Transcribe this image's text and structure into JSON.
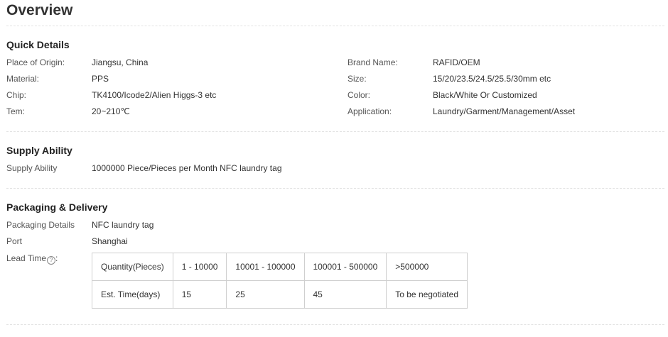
{
  "title": "Overview",
  "quick_details": {
    "heading": "Quick Details",
    "left": [
      {
        "label": "Place of Origin:",
        "value": "Jiangsu, China"
      },
      {
        "label": "Material:",
        "value": "PPS"
      },
      {
        "label": "Chip:",
        "value": "TK4100/Icode2/Alien Higgs-3 etc"
      },
      {
        "label": "Tem:",
        "value": "20~210℃"
      }
    ],
    "right": [
      {
        "label": "Brand Name:",
        "value": "RAFID/OEM"
      },
      {
        "label": "Size:",
        "value": "15/20/23.5/24.5/25.5/30mm etc"
      },
      {
        "label": "Color:",
        "value": "Black/White Or Customized"
      },
      {
        "label": "Application:",
        "value": "Laundry/Garment/Management/Asset"
      }
    ]
  },
  "supply_ability": {
    "heading": "Supply Ability",
    "label": "Supply Ability",
    "value": "1000000 Piece/Pieces per Month NFC laundry tag"
  },
  "packaging": {
    "heading": "Packaging & Delivery",
    "details_label": "Packaging Details",
    "details_value": "NFC laundry tag",
    "port_label": "Port",
    "port_value": "Shanghai",
    "lead_time_label": "Lead Time",
    "lead_time_suffix": ":",
    "help_icon": "question-circle-icon",
    "help_glyph": "?",
    "lead_table": {
      "rows": [
        [
          "Quantity(Pieces)",
          "1 - 10000",
          "10001 - 100000",
          "100001 - 500000",
          ">500000"
        ],
        [
          "Est. Time(days)",
          "15",
          "25",
          "45",
          "To be negotiated"
        ]
      ]
    }
  }
}
